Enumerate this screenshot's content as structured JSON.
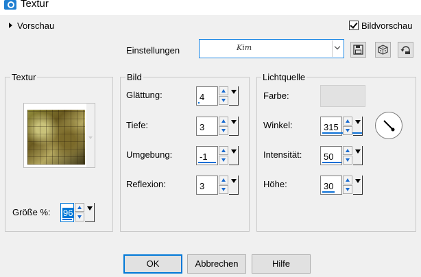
{
  "window": {
    "title": "Textur"
  },
  "preview": {
    "label": "Vorschau"
  },
  "bildvorschau": {
    "label": "Bildvorschau",
    "checked": true
  },
  "settings": {
    "label": "Einstellungen",
    "preset_value": "Kim"
  },
  "toolbar": {
    "save_icon": "floppy-disk-icon",
    "random_icon": "dice-icon",
    "reset_icon": "reset-arrow-icon"
  },
  "textur": {
    "title": "Textur",
    "size_label": "Größe %:",
    "size_value": "96"
  },
  "bild": {
    "title": "Bild",
    "fields": [
      {
        "label": "Glättung:",
        "value": "4"
      },
      {
        "label": "Tiefe:",
        "value": "3"
      },
      {
        "label": "Umgebung:",
        "value": "-1"
      },
      {
        "label": "Reflexion:",
        "value": "3"
      }
    ]
  },
  "licht": {
    "title": "Lichtquelle",
    "color_label": "Farbe:",
    "color": "#e2e2e2",
    "fields": [
      {
        "label": "Winkel:",
        "value": "315"
      },
      {
        "label": "Intensität:",
        "value": "50"
      },
      {
        "label": "Höhe:",
        "value": "30"
      }
    ]
  },
  "buttons": {
    "ok": "OK",
    "cancel": "Abbrechen",
    "help": "Hilfe"
  },
  "colors": {
    "accent": "#0078d7",
    "spin_arrow": "#1a6bd0"
  }
}
